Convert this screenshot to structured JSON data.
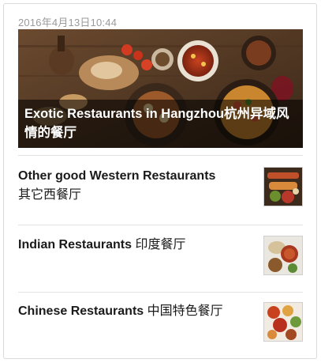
{
  "post": {
    "timestamp": "2016年4月13日10:44"
  },
  "featured": {
    "title": "Exotic Restaurants in Hangzhou杭州异域风情的餐厅"
  },
  "articles": [
    {
      "title_en": "Other good Western Restaurants",
      "title_zh": "其它西餐厅",
      "thumb_icon": "western-food-thumbnail"
    },
    {
      "title_en": "Indian Restaurants",
      "title_zh": "印度餐厅",
      "thumb_icon": "indian-food-thumbnail"
    },
    {
      "title_en": "Chinese Restaurants",
      "title_zh": "中国特色餐厅",
      "thumb_icon": "chinese-food-thumbnail"
    }
  ],
  "colors": {
    "timestamp": "#9a9a9a",
    "title_text": "#1a1a1a",
    "caption_overlay": "rgba(0,0,0,0.55)"
  }
}
